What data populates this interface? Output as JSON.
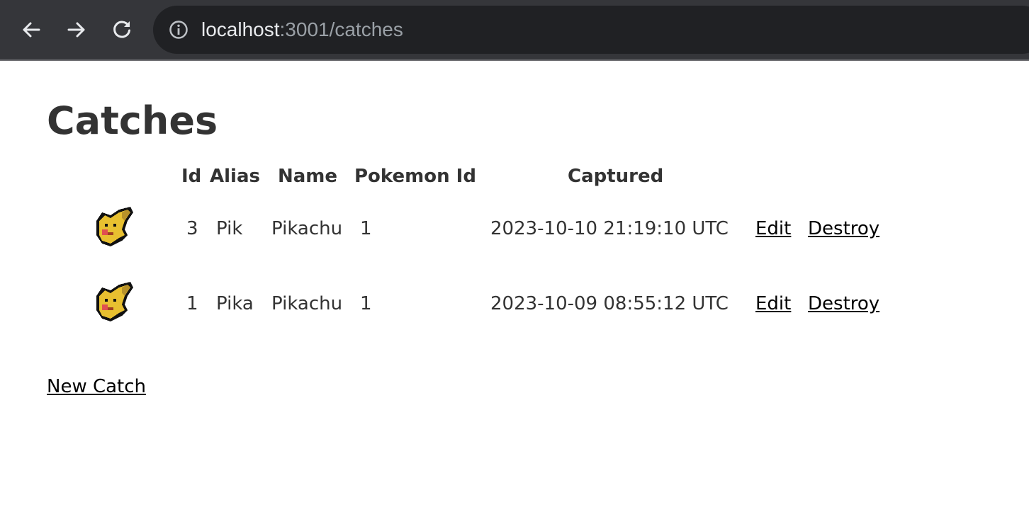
{
  "browser": {
    "url_host": "localhost",
    "url_rest": ":3001/catches",
    "icons": {
      "back": "arrow-left-icon",
      "forward": "arrow-right-icon",
      "reload": "reload-icon",
      "info": "info-icon"
    }
  },
  "page": {
    "title": "Catches",
    "new_link": "New Catch"
  },
  "table": {
    "headers": [
      "Id",
      "Alias",
      "Name",
      "Pokemon Id",
      "Captured"
    ],
    "rows": [
      {
        "sprite": "pikachu-sprite",
        "id": "3",
        "alias": "Pik",
        "name": "Pikachu",
        "pokemon_id": "1",
        "captured": "2023-10-10 21:19:10 UTC",
        "edit": "Edit",
        "destroy": "Destroy"
      },
      {
        "sprite": "pikachu-sprite",
        "id": "1",
        "alias": "Pika",
        "name": "Pikachu",
        "pokemon_id": "1",
        "captured": "2023-10-09 08:55:12 UTC",
        "edit": "Edit",
        "destroy": "Destroy"
      }
    ]
  },
  "colors": {
    "browser_bar": "#35363a",
    "omnibox": "#202124",
    "text": "#333333",
    "link": "#000000"
  }
}
